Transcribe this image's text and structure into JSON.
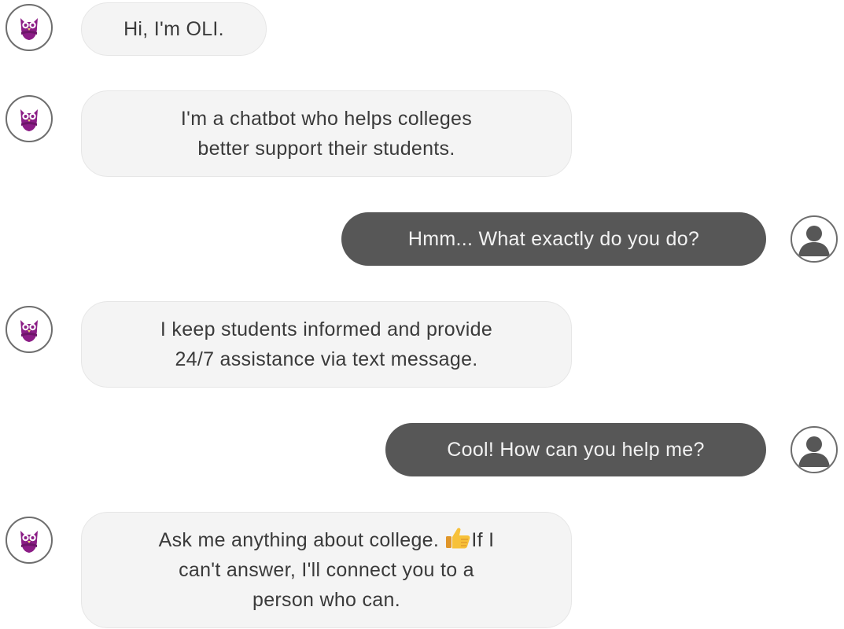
{
  "bot": {
    "name": "OLI",
    "accent_color": "#8b1d86",
    "avatar_icon": "owl-icon"
  },
  "user": {
    "avatar_icon": "user-icon"
  },
  "messages": [
    {
      "sender": "bot",
      "text": "Hi, I'm OLI."
    },
    {
      "sender": "bot",
      "line1": "I'm a chatbot who helps colleges",
      "line2": "better support their students."
    },
    {
      "sender": "user",
      "text": "Hmm... What exactly do you do?"
    },
    {
      "sender": "bot",
      "line1": "I keep students informed and provide",
      "line2": "24/7 assistance via text message."
    },
    {
      "sender": "user",
      "text": "Cool! How can you help me?"
    },
    {
      "sender": "bot",
      "line1a": "Ask me anything about college. ",
      "emoji": "thumbs-up-emoji",
      "line1b": "If I",
      "line2": "can't answer, I'll connect you to a",
      "line3": "person who can."
    }
  ]
}
